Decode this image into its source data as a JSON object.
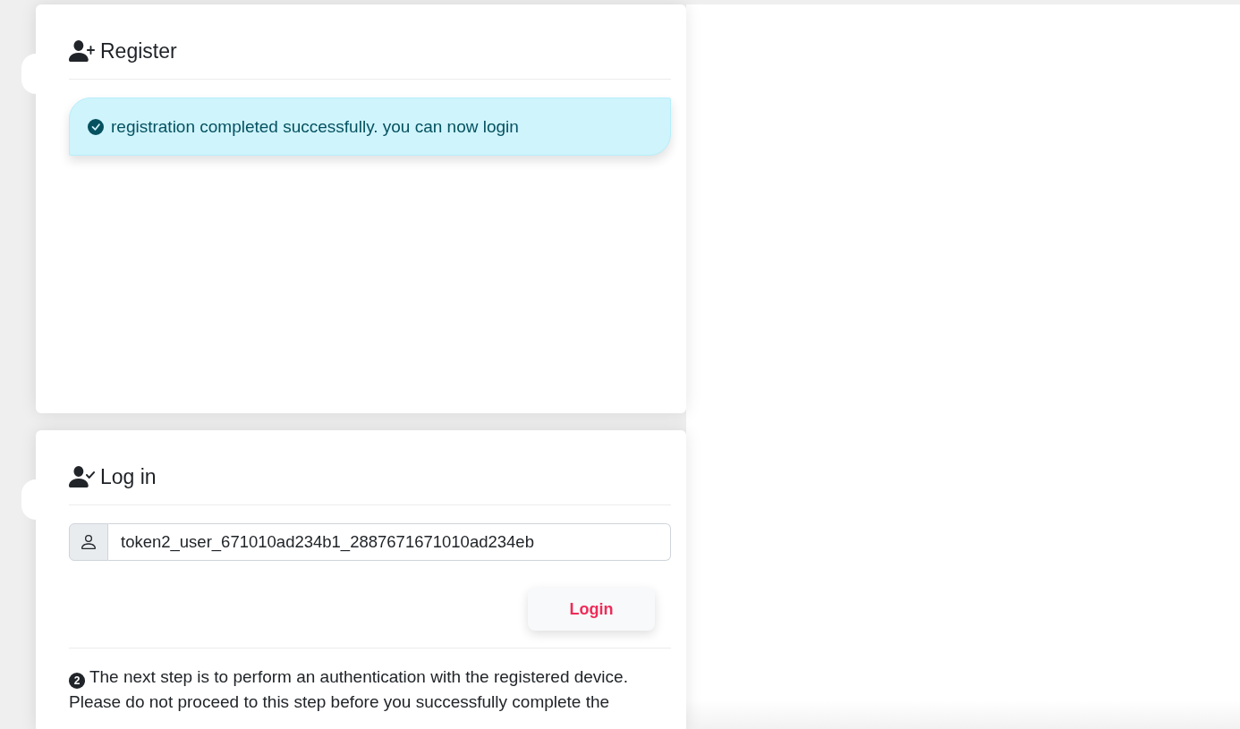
{
  "cards": [
    {
      "kind": "register",
      "title": "Register",
      "alert": {
        "kind": "success",
        "message": "registration completed successfully. you can now login"
      }
    },
    {
      "kind": "login",
      "title": "Log in",
      "username_field": {
        "value": "token2_user_671010ad234b1_2887671671010ad234eb"
      },
      "login_button": "Login",
      "step": {
        "number": "2",
        "text": "The next step is to perform an authentication with the registered device. Please do not proceed to this step before you successfully complete the"
      }
    }
  ]
}
